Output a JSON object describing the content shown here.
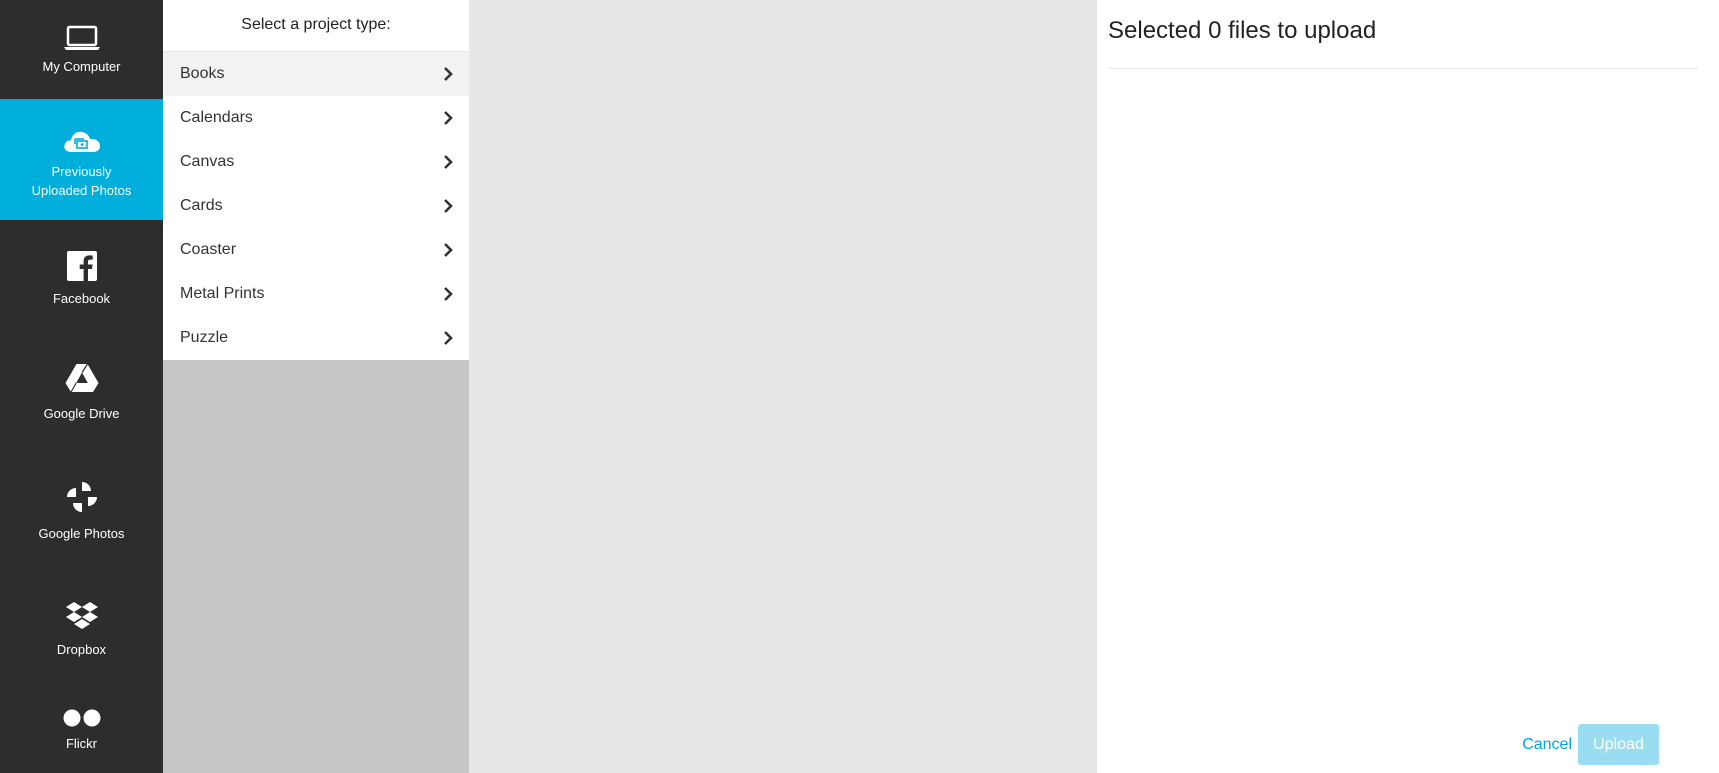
{
  "sidebar": {
    "items": [
      {
        "label": "My Computer",
        "icon": "laptop-icon",
        "active": false
      },
      {
        "label_line1": "Previously",
        "label_line2": "Uploaded Photos",
        "icon": "cloud-photos-icon",
        "active": true
      },
      {
        "label": "Facebook",
        "icon": "facebook-icon",
        "active": false
      },
      {
        "label": "Google Drive",
        "icon": "google-drive-icon",
        "active": false
      },
      {
        "label": "Google Photos",
        "icon": "google-photos-icon",
        "active": false
      },
      {
        "label": "Dropbox",
        "icon": "dropbox-icon",
        "active": false
      },
      {
        "label": "Flickr",
        "icon": "flickr-icon",
        "active": false
      }
    ]
  },
  "projects": {
    "header": "Select a project type:",
    "items": [
      {
        "label": "Books"
      },
      {
        "label": "Calendars"
      },
      {
        "label": "Canvas"
      },
      {
        "label": "Cards"
      },
      {
        "label": "Coaster"
      },
      {
        "label": "Metal Prints"
      },
      {
        "label": "Puzzle"
      }
    ]
  },
  "upload": {
    "title": "Selected 0 files to upload",
    "cancel_label": "Cancel",
    "upload_label": "Upload"
  },
  "colors": {
    "sidebar_bg": "#2d2d2d",
    "accent": "#00aedc",
    "upload_disabled": "#9adcf0"
  }
}
